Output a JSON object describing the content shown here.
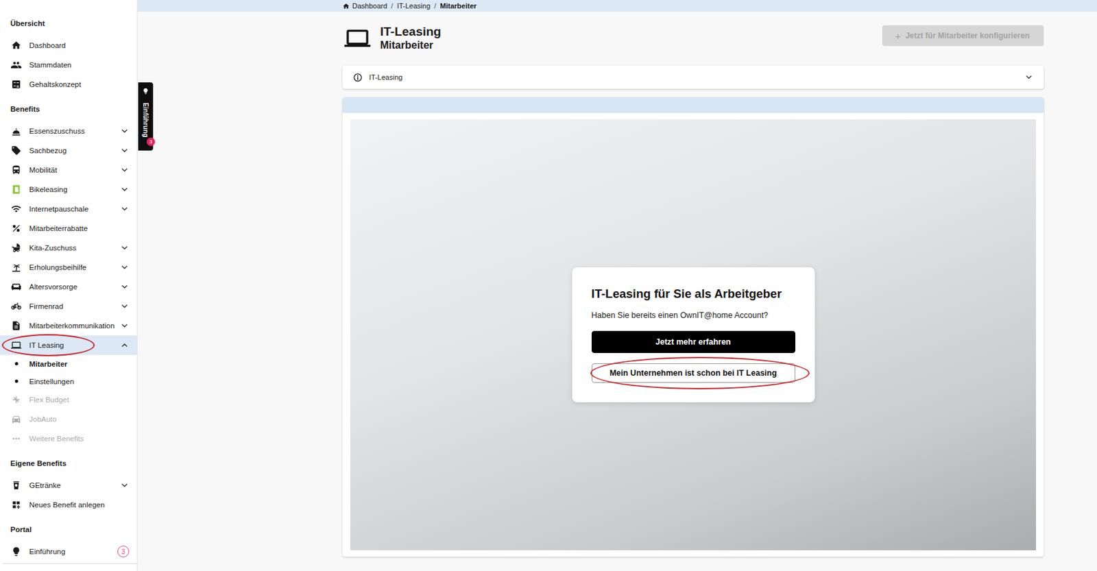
{
  "breadcrumb": [
    {
      "label": "Dashboard",
      "current": false
    },
    {
      "label": "IT-Leasing",
      "current": false
    },
    {
      "label": "Mitarbeiter",
      "current": true
    }
  ],
  "sidebar": {
    "sections": [
      {
        "title": "Übersicht",
        "items": [
          {
            "label": "Dashboard",
            "selected": false,
            "disabled": false,
            "expandable": false,
            "expanded": false,
            "circled": false,
            "children": []
          },
          {
            "label": "Stammdaten",
            "selected": false,
            "disabled": false,
            "expandable": false,
            "expanded": false,
            "circled": false,
            "children": []
          },
          {
            "label": "Gehaltskonzept",
            "selected": false,
            "disabled": false,
            "expandable": false,
            "expanded": false,
            "circled": false,
            "children": []
          }
        ]
      },
      {
        "title": "Benefits",
        "items": [
          {
            "label": "Essenszuschuss",
            "selected": false,
            "disabled": false,
            "expandable": true,
            "expanded": false,
            "circled": false,
            "children": []
          },
          {
            "label": "Sachbezug",
            "selected": false,
            "disabled": false,
            "expandable": true,
            "expanded": false,
            "circled": false,
            "children": []
          },
          {
            "label": "Mobilität",
            "selected": false,
            "disabled": false,
            "expandable": true,
            "expanded": false,
            "circled": false,
            "children": []
          },
          {
            "label": "Bikeleasing",
            "selected": false,
            "disabled": false,
            "expandable": true,
            "expanded": false,
            "circled": false,
            "children": []
          },
          {
            "label": "Internetpauschale",
            "selected": false,
            "disabled": false,
            "expandable": true,
            "expanded": false,
            "circled": false,
            "children": []
          },
          {
            "label": "Mitarbeiterrabatte",
            "selected": false,
            "disabled": false,
            "expandable": false,
            "expanded": false,
            "circled": false,
            "children": []
          },
          {
            "label": "Kita-Zuschuss",
            "selected": false,
            "disabled": false,
            "expandable": true,
            "expanded": false,
            "circled": false,
            "children": []
          },
          {
            "label": "Erholungsbeihilfe",
            "selected": false,
            "disabled": false,
            "expandable": true,
            "expanded": false,
            "circled": false,
            "children": []
          },
          {
            "label": "Altersvorsorge",
            "selected": false,
            "disabled": false,
            "expandable": true,
            "expanded": false,
            "circled": false,
            "children": []
          },
          {
            "label": "Firmenrad",
            "selected": false,
            "disabled": false,
            "expandable": true,
            "expanded": false,
            "circled": false,
            "children": []
          },
          {
            "label": "Mitarbeiterkommunikation",
            "selected": false,
            "disabled": false,
            "expandable": true,
            "expanded": false,
            "circled": false,
            "children": []
          },
          {
            "label": "IT Leasing",
            "selected": true,
            "disabled": false,
            "expandable": true,
            "expanded": true,
            "circled": true,
            "children": [
              {
                "label": "Mitarbeiter",
                "selected": true
              },
              {
                "label": "Einstellungen",
                "selected": false
              }
            ]
          },
          {
            "label": "Flex Budget",
            "selected": false,
            "disabled": true,
            "expandable": false,
            "expanded": false,
            "circled": false,
            "children": []
          },
          {
            "label": "JobAuto",
            "selected": false,
            "disabled": true,
            "expandable": false,
            "expanded": false,
            "circled": false,
            "children": []
          },
          {
            "label": "Weitere Benefits",
            "selected": false,
            "disabled": true,
            "expandable": false,
            "expanded": false,
            "circled": false,
            "children": []
          }
        ]
      },
      {
        "title": "Eigene Benefits",
        "items": [
          {
            "label": "GEtränke",
            "selected": false,
            "disabled": false,
            "expandable": true,
            "expanded": false,
            "circled": false,
            "children": []
          },
          {
            "label": "Neues Benefit anlegen",
            "selected": false,
            "disabled": false,
            "expandable": false,
            "expanded": false,
            "circled": false,
            "children": []
          }
        ]
      },
      {
        "title": "Portal",
        "items": [
          {
            "label": "Einführung",
            "selected": false,
            "disabled": false,
            "expandable": false,
            "expanded": false,
            "circled": false,
            "badge": "3",
            "children": []
          }
        ]
      }
    ]
  },
  "intro_tab": {
    "label": "Einführung",
    "badge": "3"
  },
  "page": {
    "title": "IT-Leasing",
    "subtitle": "Mitarbeiter",
    "action": {
      "icon": "+",
      "label": "Jetzt für Mitarbeiter konfigurieren",
      "disabled": true
    }
  },
  "accordion": {
    "label": "IT-Leasing",
    "expanded": false
  },
  "dialog": {
    "title": "IT-Leasing für Sie als Arbeitgeber",
    "text": "Haben Sie bereits einen OwnIT@home Account?",
    "buttons": [
      {
        "label": "Jetzt mehr erfahren",
        "kind": "primary",
        "circled": false
      },
      {
        "label": "Mein Unternehmen ist schon bei IT Leasing",
        "kind": "secondary",
        "circled": true
      }
    ]
  }
}
